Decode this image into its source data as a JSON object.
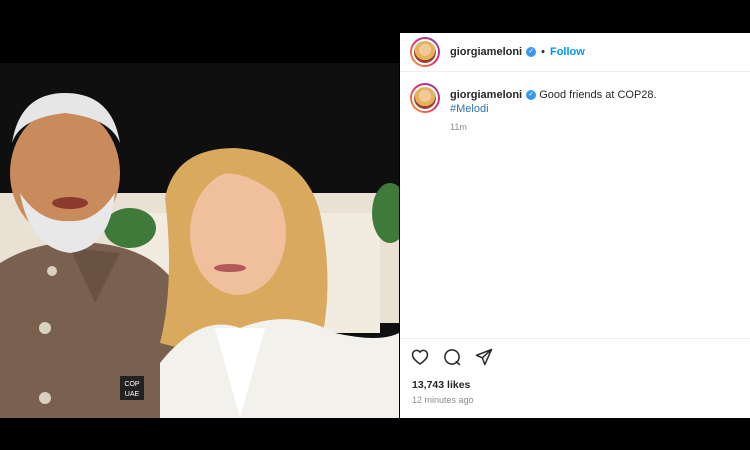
{
  "post": {
    "username": "giorgiameloni",
    "verified_icon": "verified-badge-icon",
    "dot": "•",
    "follow_label": "Follow",
    "caption": "Good friends at COP28.",
    "hashtag": "#Melodi",
    "relative_time": "11m",
    "likes": "13,743 likes",
    "timestamp": "12 minutes ago"
  },
  "photo": {
    "badge_text_1": "COP",
    "badge_text_2": "UAE"
  },
  "icons": {
    "like": "heart-icon",
    "comment": "comment-icon",
    "share": "share-icon"
  },
  "colors": {
    "link_blue": "#0095f6",
    "verified_blue": "#3897f0",
    "secondary_text": "#8e8e8e",
    "primary_text": "#262626"
  }
}
